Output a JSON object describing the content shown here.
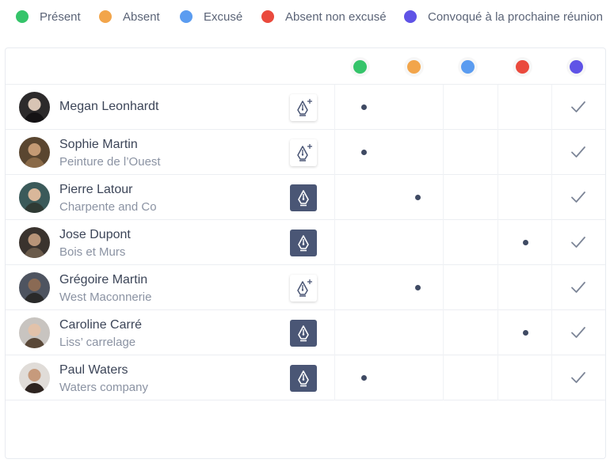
{
  "colors": {
    "present": "#35c46a",
    "absent": "#f2a54b",
    "excused": "#5b9cf0",
    "absent_unexcused": "#ea4a3d",
    "convoked": "#5f53e6",
    "sign_filled_bg": "#4a5675",
    "mark": "#3f4a63"
  },
  "legend": [
    {
      "key": "present",
      "label": "Présent"
    },
    {
      "key": "absent",
      "label": "Absent"
    },
    {
      "key": "excused",
      "label": "Excusé"
    },
    {
      "key": "absent_unexcused",
      "label": "Absent non excusé"
    },
    {
      "key": "convoked",
      "label": "Convoqué à la prochaine réunion"
    }
  ],
  "columns": [
    "present",
    "absent",
    "excused",
    "absent_unexcused",
    "convoked"
  ],
  "attendees": [
    {
      "name": "Megan Leonhardt",
      "company": "",
      "signed": false,
      "status": "present",
      "convoked": true,
      "avatar_icon": "user-avatar"
    },
    {
      "name": "Sophie Martin",
      "company": "Peinture de l’Ouest",
      "signed": false,
      "status": "present",
      "convoked": true,
      "avatar_icon": "user-avatar"
    },
    {
      "name": "Pierre Latour",
      "company": "Charpente and Co",
      "signed": true,
      "status": "absent",
      "convoked": true,
      "avatar_icon": "user-avatar"
    },
    {
      "name": "Jose Dupont",
      "company": "Bois et Murs",
      "signed": true,
      "status": "absent_unexcused",
      "convoked": true,
      "avatar_icon": "user-avatar"
    },
    {
      "name": "Grégoire Martin",
      "company": "West Maconnerie",
      "signed": false,
      "status": "absent",
      "convoked": true,
      "avatar_icon": "user-avatar"
    },
    {
      "name": "Caroline  Carré",
      "company": "Liss’ carrelage",
      "signed": true,
      "status": "absent_unexcused",
      "convoked": true,
      "avatar_icon": "user-avatar"
    },
    {
      "name": "Paul Waters",
      "company": "Waters company",
      "signed": true,
      "status": "present",
      "convoked": true,
      "avatar_icon": "user-avatar"
    }
  ],
  "icons": {
    "sign_add": "pen-nib-plus-icon",
    "signed": "pen-nib-icon",
    "convoked": "check-icon"
  }
}
